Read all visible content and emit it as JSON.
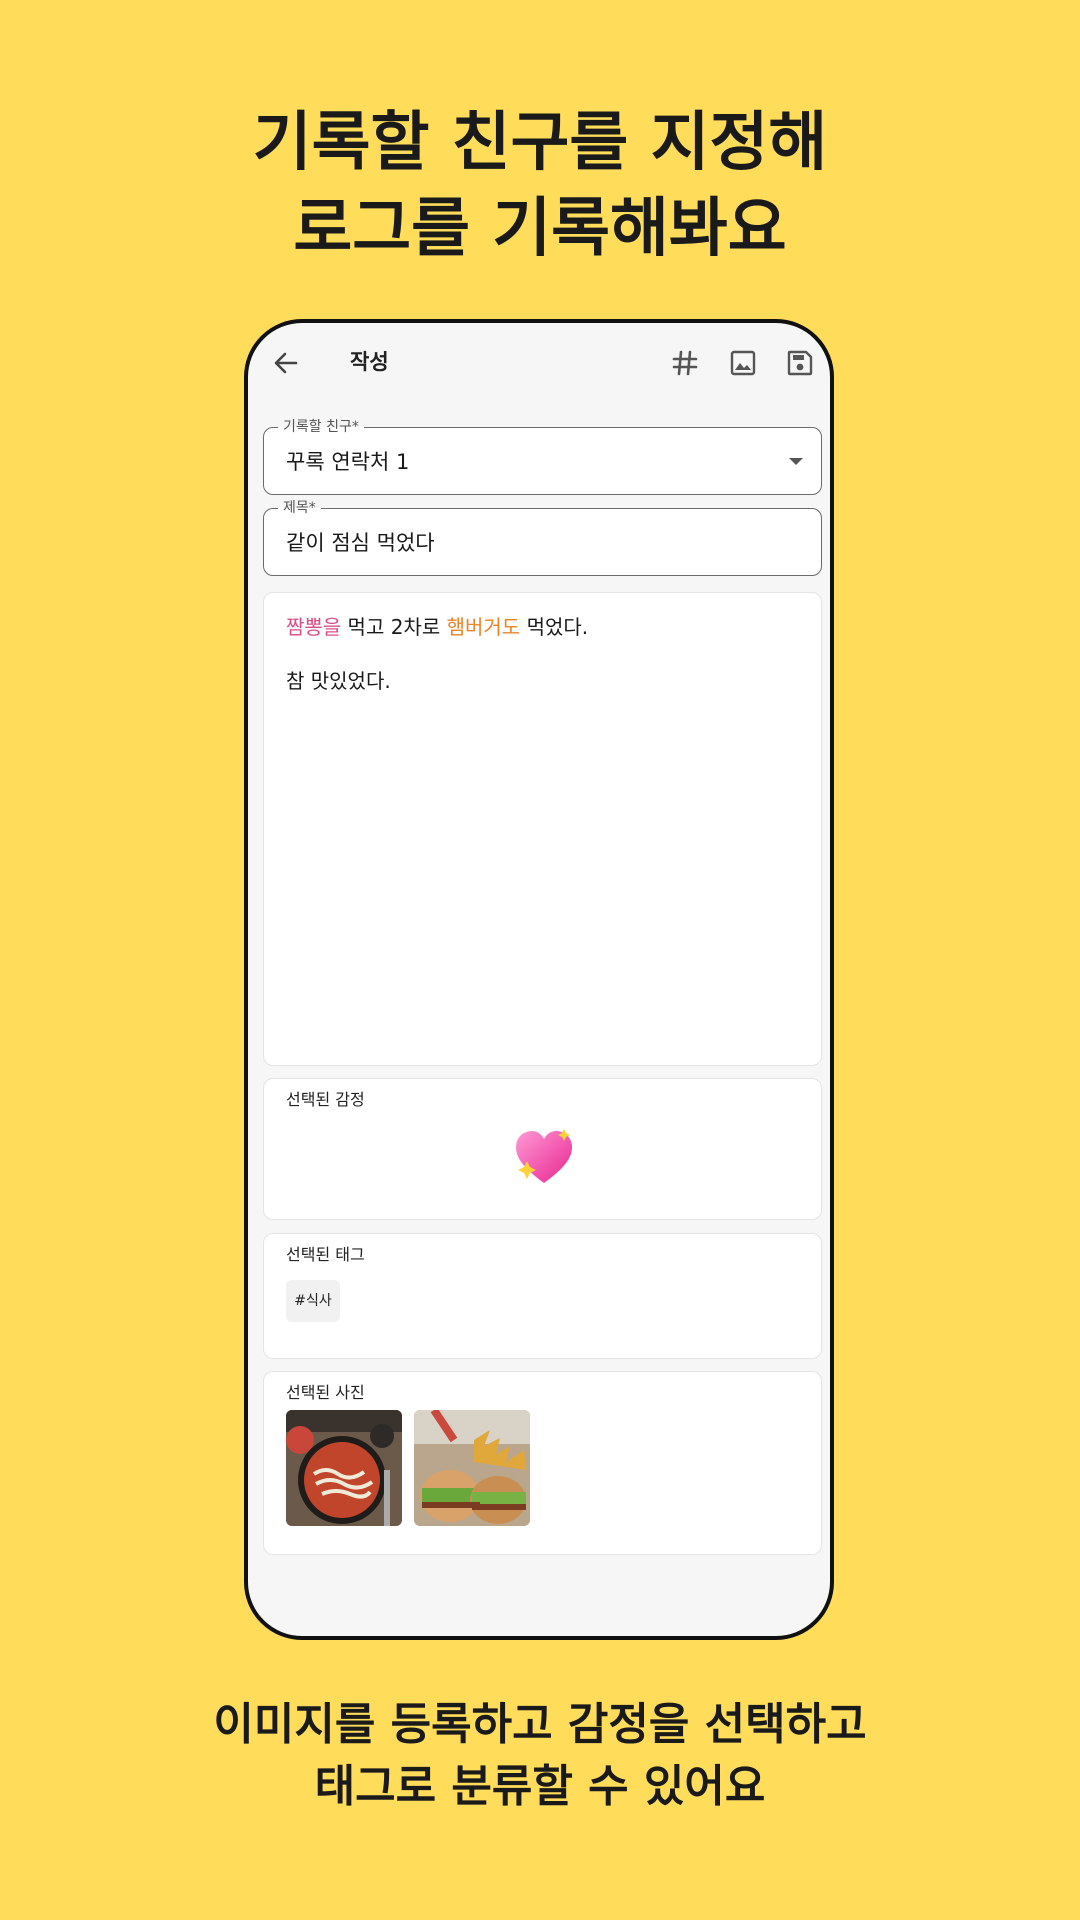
{
  "headline_top": {
    "line1": "기록할 친구를 지정해",
    "line2": "로그를 기록해봐요"
  },
  "headline_bottom": {
    "line1": "이미지를 등록하고 감정을 선택하고",
    "line2": "태그로 분류할 수 있어요"
  },
  "appbar": {
    "title": "작성",
    "icons": [
      "back-arrow-icon",
      "hashtag-icon",
      "image-icon",
      "save-icon"
    ]
  },
  "friend_field": {
    "label": "기록할 친구*",
    "value": "꾸록 연락처 1"
  },
  "title_field": {
    "label": "제목*",
    "value": "같이 점심 먹었다"
  },
  "body": {
    "line1": {
      "kw1": "짬뽕을",
      "t1": " 먹고 2차로 ",
      "kw2": "햄버거도",
      "t2": " 먹었다."
    },
    "line2": "참 맛있었다."
  },
  "emotion": {
    "label": "선택된 감정",
    "emoji": "sparkling-heart"
  },
  "tags": {
    "label": "선택된 태그",
    "items": [
      "#식사"
    ]
  },
  "photos": {
    "label": "선택된 사진",
    "items": [
      "jjamppong-photo",
      "hamburger-photo"
    ]
  },
  "colors": {
    "background": "#FFDD5B",
    "keyword_pink": "#D94F8A",
    "keyword_orange": "#E8852A"
  }
}
